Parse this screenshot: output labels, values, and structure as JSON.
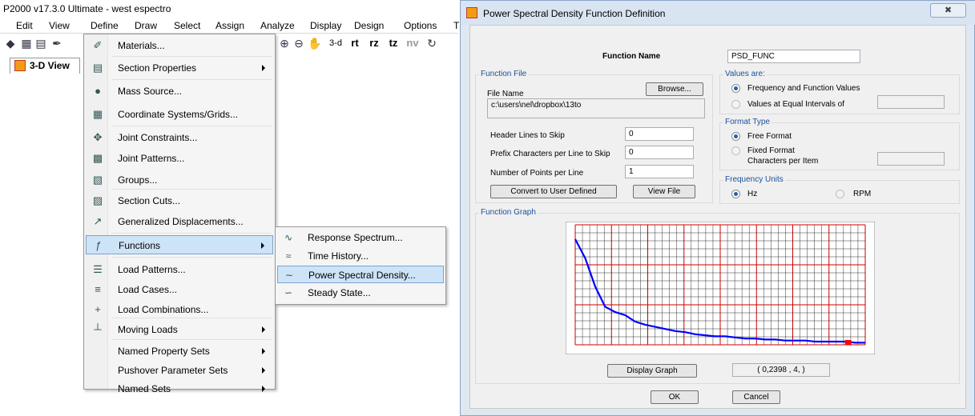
{
  "app": {
    "title": "P2000 v17.3.0 Ultimate  - west espectro",
    "menus": [
      "Edit",
      "View",
      "Define",
      "Draw",
      "Select",
      "Assign",
      "Analyze",
      "Display",
      "Design",
      "Options",
      "T"
    ],
    "toolbar_text": [
      "3-d",
      "rt",
      "rz",
      "tz",
      "nv"
    ],
    "view_tab": "3-D View"
  },
  "define_menu": {
    "items": [
      {
        "label": "Materials...",
        "icon": "materials-icon",
        "arrow": false
      },
      {
        "label": "Section Properties",
        "icon": "section-properties-icon",
        "arrow": true
      },
      {
        "label": "Mass Source...",
        "icon": "mass-source-icon",
        "arrow": false
      },
      {
        "label": "Coordinate Systems/Grids...",
        "icon": "grid-icon",
        "arrow": false
      },
      {
        "label": "Joint Constraints...",
        "icon": "joint-constraints-icon",
        "arrow": false
      },
      {
        "label": "Joint Patterns...",
        "icon": "joint-patterns-icon",
        "arrow": false
      },
      {
        "label": "Groups...",
        "icon": "groups-icon",
        "arrow": false
      },
      {
        "label": "Section Cuts...",
        "icon": "section-cuts-icon",
        "arrow": false
      },
      {
        "label": "Generalized Displacements...",
        "icon": "generalized-displacements-icon",
        "arrow": false
      },
      {
        "label": "Functions",
        "icon": "functions-icon",
        "arrow": true,
        "highlighted": true
      },
      {
        "label": "Load Patterns...",
        "icon": "load-patterns-icon",
        "arrow": false
      },
      {
        "label": "Load Cases...",
        "icon": "load-cases-icon",
        "arrow": false
      },
      {
        "label": "Load Combinations...",
        "icon": "load-combinations-icon",
        "arrow": false
      },
      {
        "label": "Moving Loads",
        "icon": "moving-loads-icon",
        "arrow": true
      },
      {
        "label": "Named Property Sets",
        "icon": "",
        "arrow": true
      },
      {
        "label": "Pushover Parameter Sets",
        "icon": "",
        "arrow": true
      },
      {
        "label": "Named Sets",
        "icon": "",
        "arrow": true
      }
    ]
  },
  "functions_submenu": {
    "items": [
      {
        "label": "Response Spectrum...",
        "icon": "response-spectrum-icon"
      },
      {
        "label": "Time History...",
        "icon": "time-history-icon"
      },
      {
        "label": "Power Spectral Density...",
        "icon": "psd-icon",
        "highlighted": true
      },
      {
        "label": "Steady State...",
        "icon": "steady-state-icon"
      }
    ]
  },
  "dialog": {
    "title": "Power Spectral Density Function Definition",
    "function_name_label": "Function Name",
    "function_name_value": "PSD_FUNC",
    "function_file": {
      "title": "Function File",
      "file_name_label": "File Name",
      "browse_label": "Browse...",
      "path": "c:\\users\\nel\\dropbox\\13to",
      "header_lines_label": "Header Lines to Skip",
      "header_lines_value": "0",
      "prefix_label": "Prefix Characters per Line to Skip",
      "prefix_value": "0",
      "points_label": "Number of Points per Line",
      "points_value": "1",
      "convert_label": "Convert to User Defined",
      "view_file_label": "View File"
    },
    "values_are": {
      "title": "Values are:",
      "opt1": "Frequency and Function Values",
      "opt2": "Values at Equal Intervals of",
      "selected": 1
    },
    "format_type": {
      "title": "Format Type",
      "opt1": "Free Format",
      "opt2": "Fixed Format",
      "chars_label": "Characters per Item",
      "selected": 1
    },
    "frequency_units": {
      "title": "Frequency Units",
      "opt1": "Hz",
      "opt2": "RPM",
      "selected": 1
    },
    "graph": {
      "title": "Function Graph",
      "display_label": "Display Graph",
      "coord_readout": "( 0,2398 ,  4, )",
      "line_color": "#0000ff",
      "grid_color": "#cc0000"
    },
    "ok_label": "OK",
    "cancel_label": "Cancel"
  },
  "chart_data": {
    "type": "line",
    "title": "",
    "xlabel": "",
    "ylabel": "",
    "grid": true,
    "series": [
      {
        "values": [
          1.0,
          0.82,
          0.55,
          0.36,
          0.31,
          0.28,
          0.22,
          0.19,
          0.17,
          0.15,
          0.13,
          0.12,
          0.1,
          0.09,
          0.08,
          0.08,
          0.07,
          0.06,
          0.06,
          0.05,
          0.05,
          0.04,
          0.04,
          0.04,
          0.03,
          0.03,
          0.03,
          0.03,
          0.02,
          0.02
        ]
      }
    ]
  }
}
